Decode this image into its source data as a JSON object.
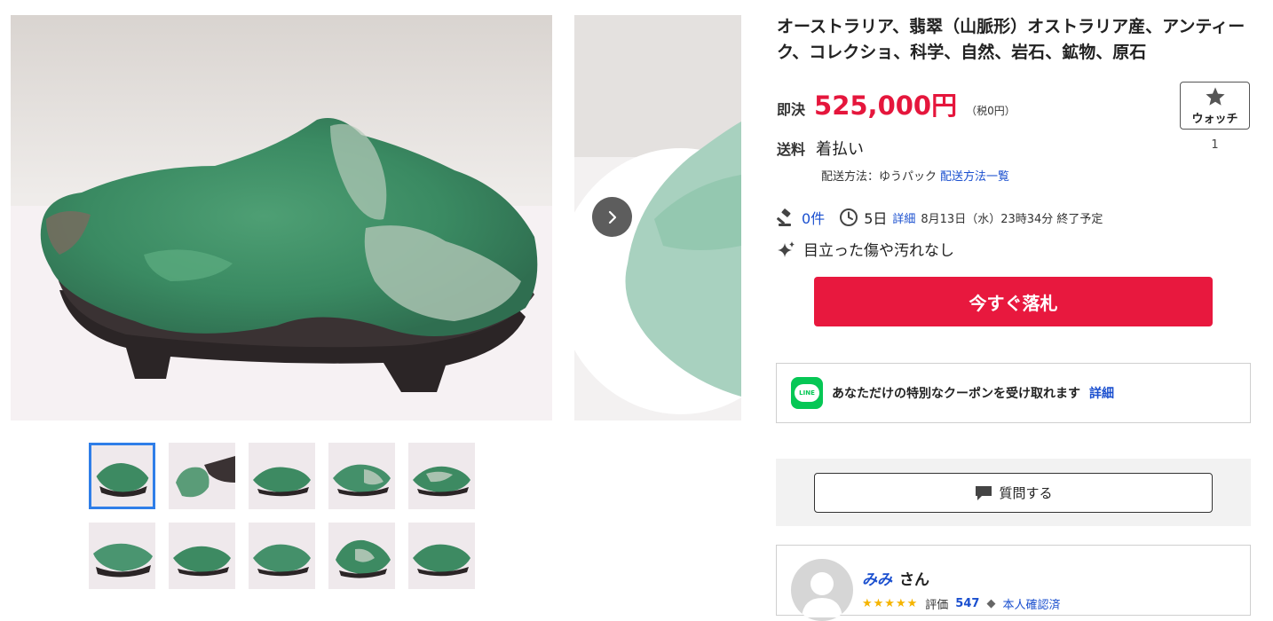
{
  "item": {
    "title": "オーストラリア、翡翠（山脈形）オストラリア産、アンティーク、コレクショ、科学、自然、岩石、鉱物、原石",
    "buy_now_label": "即決",
    "price": "525,000円",
    "tax_note": "（税0円）",
    "shipping_label": "送料",
    "shipping_value": "着払い",
    "shipping_method": "配送方法：ゆうパック",
    "shipping_list_link": "配送方法一覧",
    "bids": "0件",
    "time_left": "5日",
    "detail_link": "詳細",
    "end_time": "8月13日（水）23時34分 終了予定",
    "condition": "目立った傷や汚れなし"
  },
  "watch": {
    "label": "ウォッチ",
    "count": "1"
  },
  "actions": {
    "bid_now": "今すぐ落札",
    "question": "質問する"
  },
  "coupon": {
    "line_label": "LINE",
    "text": "あなただけの特別なクーポンを受け取れます",
    "link": "詳細"
  },
  "seller": {
    "name": "みみ",
    "suffix": "さん",
    "rating_label": "評価",
    "rating_count": "547",
    "verified": "本人確認済"
  },
  "icons": {
    "next": "chevron-right-icon",
    "watch": "star-icon",
    "bids": "gavel-icon",
    "time": "clock-icon",
    "condition": "sparkle-icon",
    "line": "line-icon",
    "question": "speech-bubble-icon",
    "avatar": "user-avatar-icon"
  },
  "colors": {
    "price": "#e5163c",
    "bid_button": "#e8183e",
    "link": "#1a4fcf",
    "thumb_selected": "#2f7ee8",
    "line": "#06c755"
  },
  "thumbnails": {
    "count": 10,
    "selected_index": 0
  }
}
